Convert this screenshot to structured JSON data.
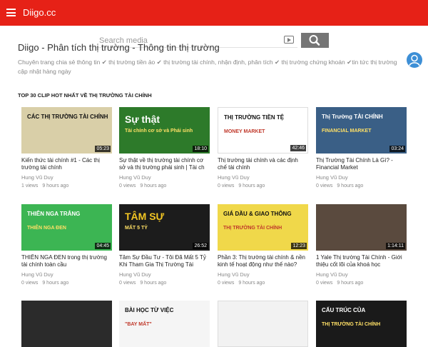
{
  "header": {
    "logo": "Diigo.cc"
  },
  "search": {
    "placeholder": "Search media"
  },
  "site": {
    "title": "Diigo - Phân tích thị trường - Thông tin thị trường",
    "description": "Chuyên trang chia sẻ thông tin ✔ thị trường tiền ảo ✔ thị trường tài chính, nhận định, phân tích ✔ thị trường chứng khoán ✔tin tức thị trường cập nhật hàng ngày"
  },
  "section": {
    "title": "TOP 30 CLIP HOT NHẤT VỀ THỊ TRƯỜNG TÀI CHÍNH"
  },
  "videos": [
    {
      "title": "Kiến thức tài chính #1 - Các thị trường tài chính",
      "channel": "Hung Vũ Duy",
      "views": "1 views",
      "age": "9 hours ago",
      "duration": "05:23",
      "thumb_text": "CÁC THỊ TRƯỜNG TÀI CHÍNH",
      "thumb_bg": "#d9cfa8"
    },
    {
      "title": "Sự thật về thị trường tài chính cơ sở và thị trường phái sinh | Tài ch",
      "channel": "Hung Vũ Duy",
      "views": "0 views",
      "age": "9 hours ago",
      "duration": "18:10",
      "thumb_text": "Sự thật",
      "thumb_sub": "Tài chính cơ sở và Phái sinh",
      "thumb_bg": "#2d7a2a"
    },
    {
      "title": "Thị trường tài chính và các định chế tài chính",
      "channel": "Hung Vũ Duy",
      "views": "0 views",
      "age": "9 hours ago",
      "duration": "42:46",
      "thumb_text": "THỊ TRƯỜNG TIỀN TỆ",
      "thumb_sub": "MONEY MARKET",
      "thumb_bg": "#ffffff"
    },
    {
      "title": "Thị Trường Tài Chính Là Gì? - Financial Market",
      "channel": "Hung Vũ Duy",
      "views": "0 views",
      "age": "9 hours ago",
      "duration": "03:24",
      "thumb_text": "Thị Trường TÀI CHÍNH",
      "thumb_sub": "FINANCIAL MARKET",
      "thumb_bg": "#3a5f86"
    },
    {
      "title": "THIÊN NGA ĐEN trong thị trường tài chính toàn cầu",
      "channel": "Hung Vũ Duy",
      "views": "0 views",
      "age": "9 hours ago",
      "duration": "04:45",
      "thumb_text": "THIÊN NGA TRẮNG",
      "thumb_sub": "THIÊN NGA ĐEN",
      "thumb_bg": "#3cb553"
    },
    {
      "title": "Tâm Sự Đầu Tư - Tôi Đã Mất 5 Tỷ Khi Tham Gia Thị Trường Tài Chính Như",
      "channel": "Hung Vũ Duy",
      "views": "0 views",
      "age": "9 hours ago",
      "duration": "26:52",
      "thumb_text": "TÂM SỰ",
      "thumb_sub": "MẤT 5 TỶ",
      "thumb_bg": "#1c1c1c"
    },
    {
      "title": "Phần 3: Thị trường tài chính & nền kinh tế hoạt động như thế nào?",
      "channel": "Hung Vũ Duy",
      "views": "0 views",
      "age": "9 hours ago",
      "duration": "12:23",
      "thumb_text": "GIÁ DẦU & GIAO THÔNG",
      "thumb_sub": "THỊ TRƯỜNG TÀI CHÍNH",
      "thumb_bg": "#f0d84a"
    },
    {
      "title": "1 Yale Thị trường Tài Chính - Giới thiệu cốt lõi của khoá học",
      "channel": "Hung Vũ Duy",
      "views": "0 views",
      "age": "9 hours ago",
      "duration": "1:14:11",
      "thumb_text": "",
      "thumb_bg": "#5a4a3e"
    },
    {
      "title": "",
      "channel": "",
      "views": "",
      "age": "",
      "duration": "",
      "thumb_text": "",
      "thumb_bg": "#2b2b2b"
    },
    {
      "title": "",
      "channel": "",
      "views": "",
      "age": "",
      "duration": "",
      "thumb_text": "BÀI HỌC TỪ VIỆC",
      "thumb_sub": "\"BAY MẤT\"",
      "thumb_bg": "#f5f5f5"
    },
    {
      "title": "",
      "channel": "",
      "views": "",
      "age": "",
      "duration": "",
      "thumb_text": "",
      "thumb_bg": "#f2f2f2"
    },
    {
      "title": "",
      "channel": "",
      "views": "",
      "age": "",
      "duration": "",
      "thumb_text": "CẤU TRÚC CỦA",
      "thumb_sub": "THỊ TRƯỜNG TÀI CHÍNH",
      "thumb_bg": "#1a1a1a"
    }
  ],
  "colors": {
    "brand": "#e62117",
    "search_button": "#757575"
  }
}
